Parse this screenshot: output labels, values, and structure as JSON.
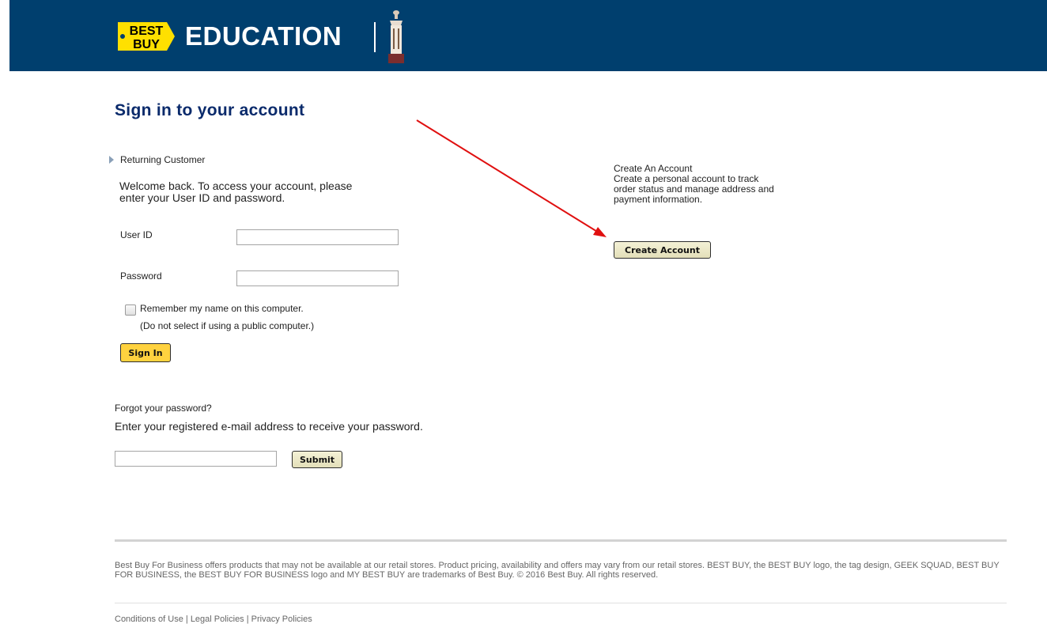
{
  "header": {
    "logo_line1": "BEST",
    "logo_line2": "BUY",
    "section": "EDUCATION",
    "brand_color": "#003f6e",
    "logo_yellow": "#ffe000"
  },
  "page_title": "Sign in to your account",
  "returning": {
    "heading": "Returning Customer",
    "welcome": "Welcome back. To access your account, please enter your User ID and password.",
    "user_id_label": "User ID",
    "user_id_value": "",
    "password_label": "Password",
    "password_value": "",
    "remember_label": "Remember my name on this computer.",
    "remember_note": "(Do not select if using a public computer.)",
    "signin_button": "Sign In"
  },
  "forgot": {
    "heading": "Forgot your password?",
    "instructions": "Enter your registered e-mail address to receive your password.",
    "email_value": "",
    "submit_button": "Submit"
  },
  "create": {
    "heading": "Create An Account",
    "description": "Create a personal account to track order status and manage address and payment information.",
    "button": "Create Account"
  },
  "annotation": {
    "arrow_color": "#e01010"
  },
  "footer": {
    "legal": "Best Buy For Business offers products that may not be available at our retail stores. Product pricing, availability and offers may vary from our retail stores. BEST BUY, the BEST BUY logo, the tag design, GEEK SQUAD, BEST BUY FOR BUSINESS, the BEST BUY FOR BUSINESS logo and MY BEST BUY are trademarks of Best Buy. © 2016 Best Buy. All rights reserved.",
    "links": [
      "Conditions of Use",
      "Legal Policies",
      "Privacy Policies"
    ],
    "separator": "|"
  }
}
